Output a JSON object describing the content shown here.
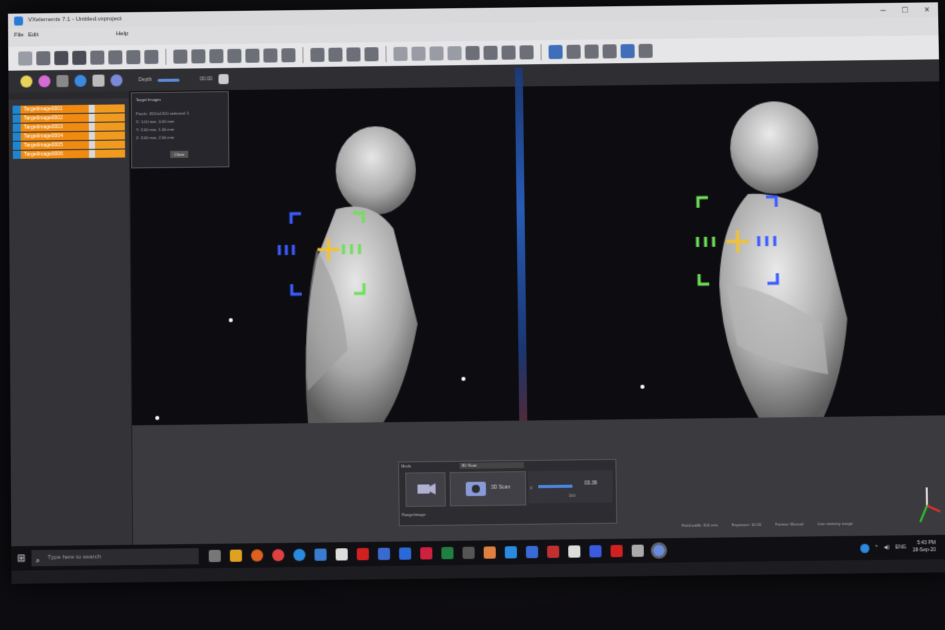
{
  "window": {
    "title": "VXelements 7.1 - Untitled.vxproject",
    "menus": [
      "File",
      "Edit",
      "Help"
    ]
  },
  "toolbar2": {
    "depth_label": "Depth",
    "depth_value": "00.00"
  },
  "sidebar": {
    "targets": [
      {
        "name": "TargetImage0001"
      },
      {
        "name": "TargetImage0002"
      },
      {
        "name": "TargetImage0003"
      },
      {
        "name": "TargetImage0004"
      },
      {
        "name": "TargetImage0005"
      },
      {
        "name": "TargetImage0006"
      }
    ]
  },
  "popup": {
    "title": "Target Images",
    "lines": [
      "Pixels: 1920x1200 selected: 5",
      "X: 1.00 mm, 0.00 mm",
      "Y: 2.00 mm, 1.00 mm",
      "Z: 3.00 mm, 2.00 mm"
    ],
    "close": "Close"
  },
  "scan_bar": {
    "mode_label": "Mode",
    "mode_value": "3D Scan",
    "scan_button": "3D Scan",
    "range_label": "Range/image",
    "exposure_min": "0",
    "exposure_max": "100",
    "exposure_value": "03.36"
  },
  "statusbar": {
    "items": [
      "Field width: 300 mm",
      "Exposure: 10.00",
      "Format: Manual",
      "Live memory usage"
    ]
  },
  "taskbar": {
    "search_placeholder": "Type here to search",
    "language": "ENG",
    "time": "5:43 PM",
    "date": "18-Sep-20"
  },
  "colors": {
    "accent_blue": "#1e86d0",
    "target_orange": "#f08a10",
    "reticle_blue": "#3a5cff",
    "reticle_green": "#6ee05a",
    "crosshair_yellow": "#f2c230"
  }
}
